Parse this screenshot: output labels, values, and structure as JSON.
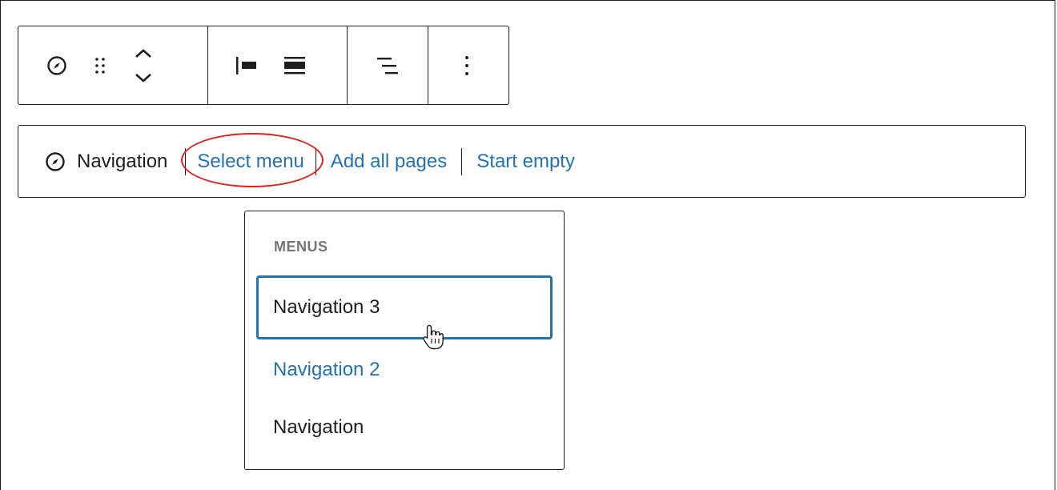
{
  "toolbar": {
    "groups": [
      {
        "items": [
          "compass-icon",
          "drag-handle-icon",
          "move-up-down-icon"
        ]
      },
      {
        "items": [
          "justify-left-icon",
          "justify-center-icon"
        ]
      },
      {
        "items": [
          "justify-right-icon"
        ]
      },
      {
        "items": [
          "more-options-icon"
        ]
      }
    ]
  },
  "placeholder": {
    "label": "Navigation",
    "actions": {
      "select_menu": "Select menu",
      "add_all_pages": "Add all pages",
      "start_empty": "Start empty"
    }
  },
  "dropdown": {
    "heading": "MENUS",
    "items": [
      "Navigation 3",
      "Navigation 2",
      "Navigation"
    ]
  },
  "colors": {
    "link": "#2271b1",
    "focus": "#2271b1",
    "annotation": "#e0211b",
    "text": "#1e1e1e",
    "heading": "#757575"
  }
}
